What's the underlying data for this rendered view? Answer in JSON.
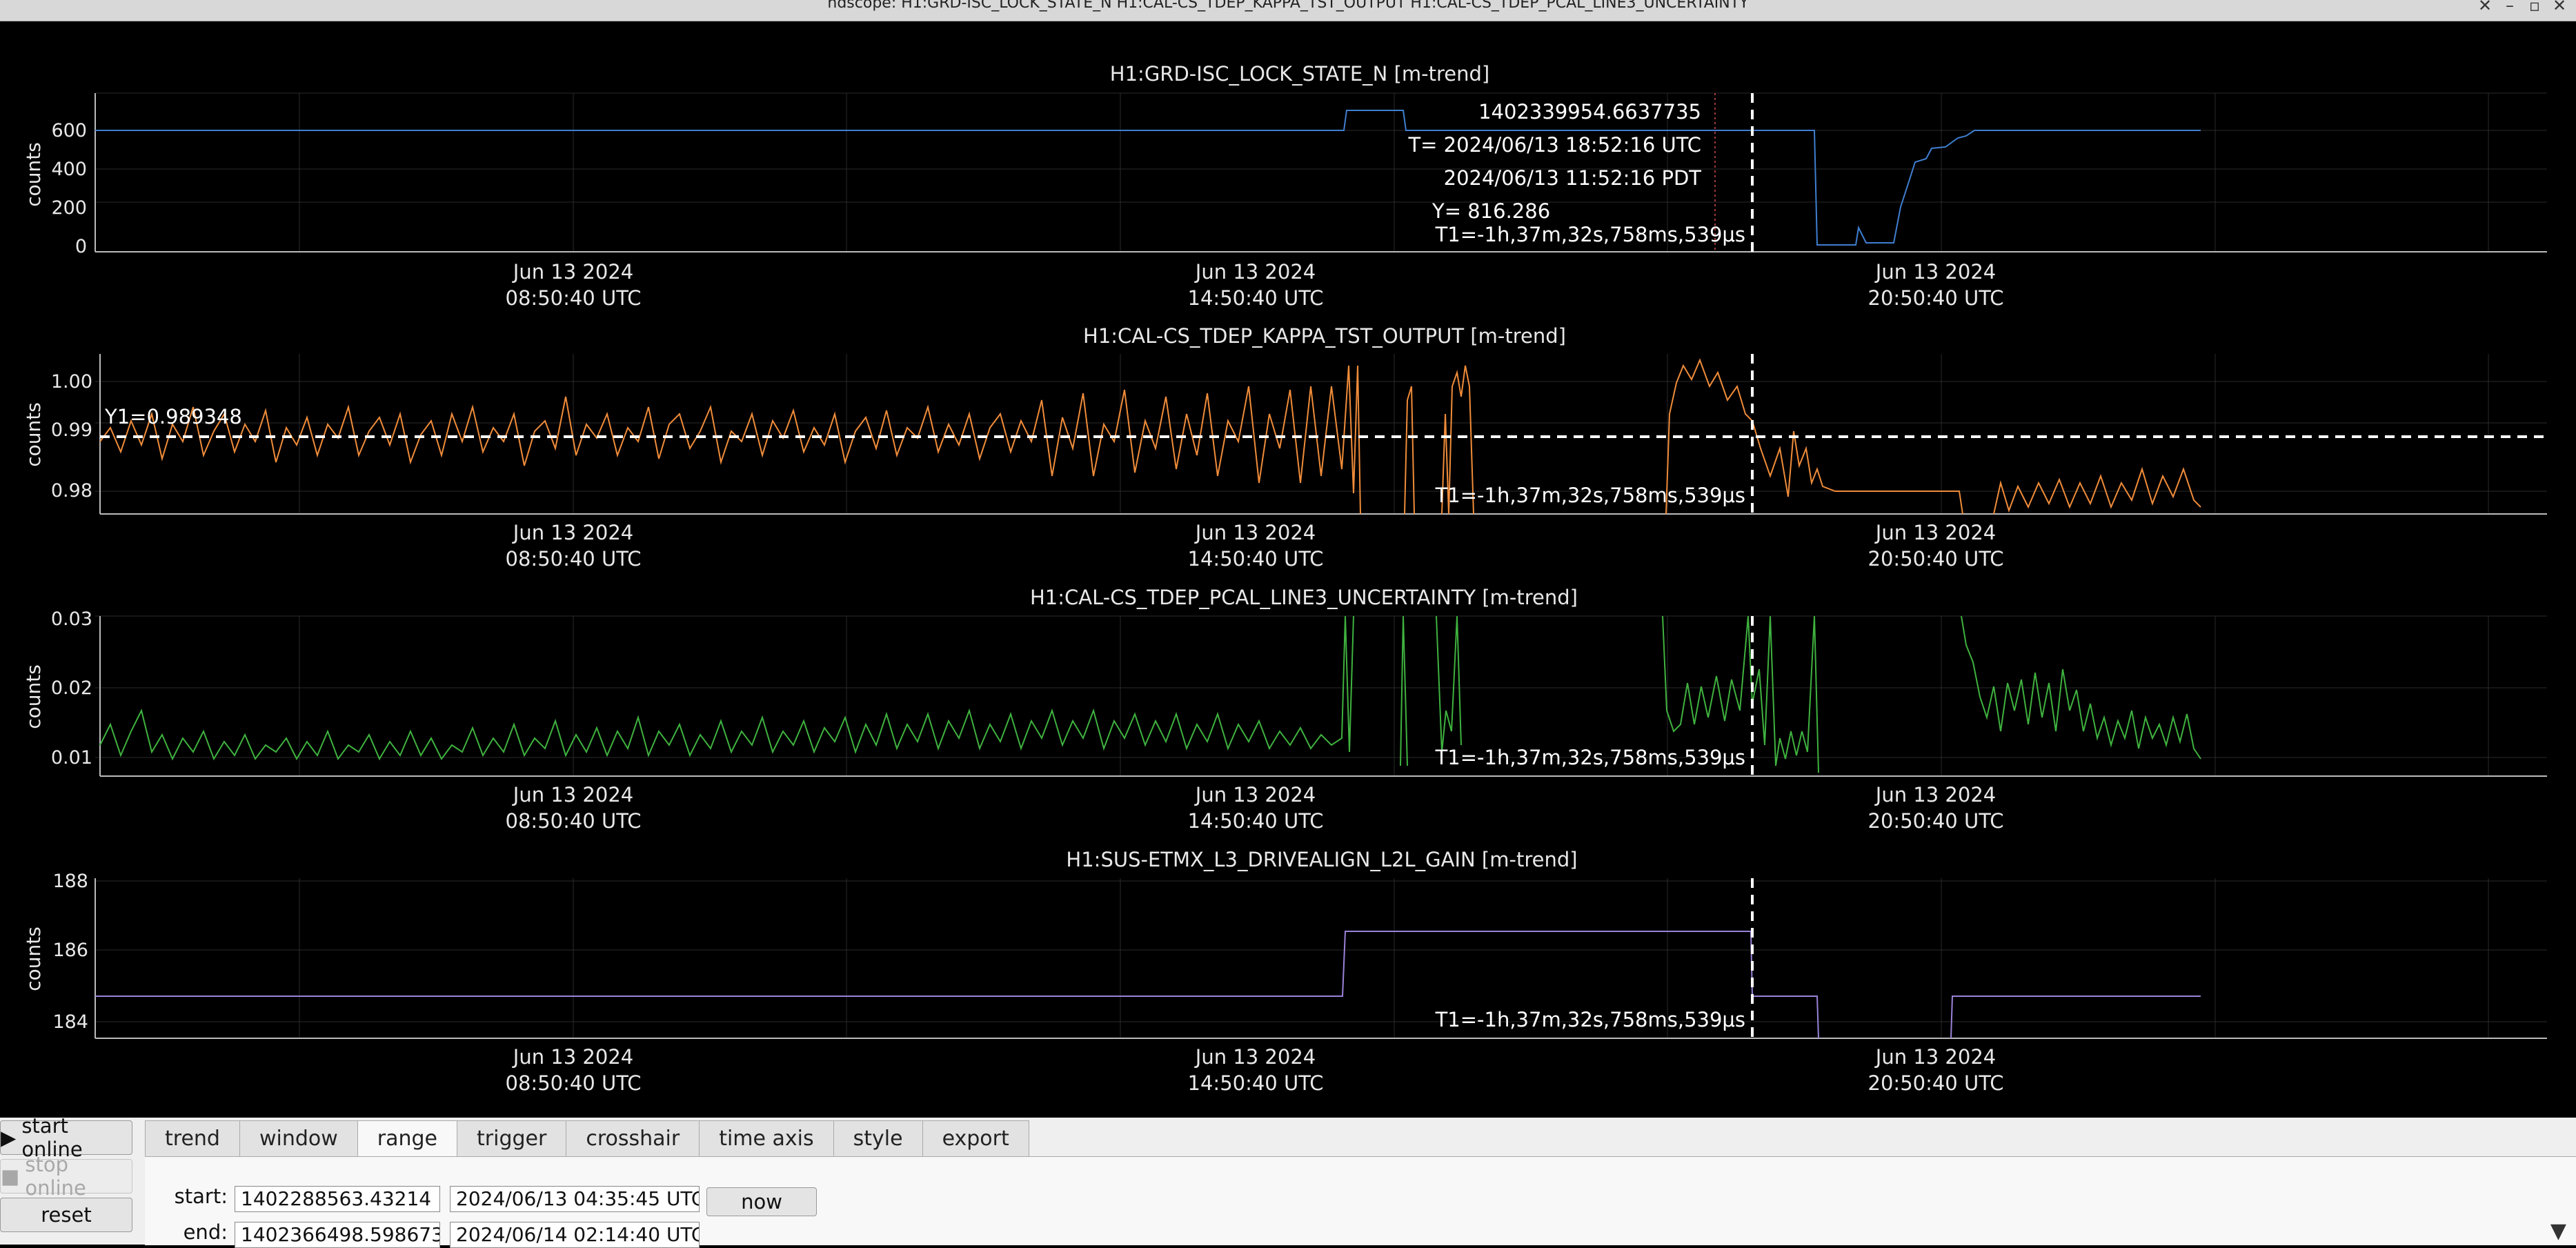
{
  "window": {
    "title": "ndscope: H1:GRD-ISC_LOCK_STATE_N H1:CAL-CS_TDEP_KAPPA_TST_OUTPUT H1:CAL-CS_TDEP_PCAL_LINE3_UNCERTAINTY",
    "minimize_icon": "minimize-icon",
    "maximize_icon": "maximize-icon",
    "close_icon": "close-icon"
  },
  "x_axis": {
    "ticks": [
      {
        "date": "Jun 13 2024",
        "time": "08:50:40 UTC"
      },
      {
        "date": "Jun 13 2024",
        "time": "14:50:40 UTC"
      },
      {
        "date": "Jun 13 2024",
        "time": "20:50:40 UTC"
      }
    ]
  },
  "plots": [
    {
      "title": "H1:GRD-ISC_LOCK_STATE_N [m-trend]",
      "ylabel": "counts",
      "yticks": [
        "600",
        "400",
        "200",
        "0"
      ],
      "color": "#3f7fd0"
    },
    {
      "title": "H1:CAL-CS_TDEP_KAPPA_TST_OUTPUT [m-trend]",
      "ylabel": "counts",
      "yticks": [
        "1.00",
        "0.99",
        "0.98"
      ],
      "color": "#f08c3a"
    },
    {
      "title": "H1:CAL-CS_TDEP_PCAL_LINE3_UNCERTAINTY [m-trend]",
      "ylabel": "counts",
      "yticks": [
        "0.03",
        "0.02",
        "0.01"
      ],
      "color": "#3fb23f"
    },
    {
      "title": "H1:SUS-ETMX_L3_DRIVEALIGN_L2L_GAIN [m-trend]",
      "ylabel": "counts",
      "yticks": [
        "188",
        "186",
        "184"
      ],
      "color": "#9a83d8"
    }
  ],
  "cursor": {
    "gps": "1402339954.6637735",
    "utc": "T= 2024/06/13 18:52:16 UTC",
    "pdt": "2024/06/13 11:52:16 PDT",
    "y_readout": "Y= 816.286",
    "t1_delta": "T1=-1h,37m,32s,758ms,539μs",
    "y1_readout": "Y1=0.989348"
  },
  "controls": {
    "start_online": "start online",
    "stop_online": "stop online",
    "reset": "reset",
    "play_icon": "play-icon",
    "stop_icon": "stop-icon",
    "tabs": [
      "trend",
      "window",
      "range",
      "trigger",
      "crosshair",
      "time axis",
      "style",
      "export"
    ],
    "active_tab": "range",
    "start_label": "start:",
    "start_gps": "1402288563.43214",
    "start_utc": "2024/06/13 04:35:45 UTC",
    "end_label": "end:",
    "end_gps": "1402366498.598673",
    "end_utc": "2024/06/14 02:14:40 UTC",
    "now_label": "now",
    "scroll_icon": "scroll-down-icon"
  }
}
